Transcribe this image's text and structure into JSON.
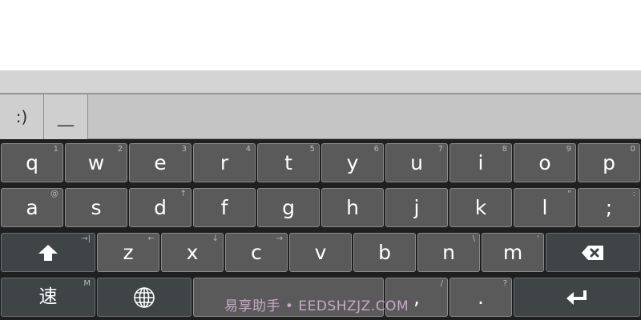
{
  "candidates": [
    ":)",
    "__"
  ],
  "rows": [
    [
      {
        "main": "q",
        "hint": "1"
      },
      {
        "main": "w",
        "hint": "2"
      },
      {
        "main": "e",
        "hint": "3"
      },
      {
        "main": "r",
        "hint": "4"
      },
      {
        "main": "t",
        "hint": "5"
      },
      {
        "main": "y",
        "hint": "6"
      },
      {
        "main": "u",
        "hint": "7"
      },
      {
        "main": "i",
        "hint": "8"
      },
      {
        "main": "o",
        "hint": "9"
      },
      {
        "main": "p",
        "hint": "0"
      }
    ],
    [
      {
        "main": "a",
        "hint": "@"
      },
      {
        "main": "s",
        "hint": ""
      },
      {
        "main": "d",
        "hint": "↑"
      },
      {
        "main": "f",
        "hint": ""
      },
      {
        "main": "g",
        "hint": ""
      },
      {
        "main": "h",
        "hint": ""
      },
      {
        "main": "j",
        "hint": ""
      },
      {
        "main": "k",
        "hint": ""
      },
      {
        "main": "l",
        "hint": "\""
      },
      {
        "main": ";",
        "hint": ":"
      }
    ],
    [
      {
        "main": "z",
        "hint": "←"
      },
      {
        "main": "x",
        "hint": "↓"
      },
      {
        "main": "c",
        "hint": "→"
      },
      {
        "main": "v",
        "hint": ""
      },
      {
        "main": "b",
        "hint": ""
      },
      {
        "main": "n",
        "hint": "\\"
      },
      {
        "main": "m",
        "hint": "'"
      }
    ]
  ],
  "shift_key": {
    "hint": "→|",
    "icon": "shift-arrow-icon"
  },
  "backspace_key": {
    "icon": "backspace-icon"
  },
  "bottom_row": {
    "lang_key": {
      "main": "速",
      "hint": "M"
    },
    "globe_key": {
      "icon": "globe-icon"
    },
    "comma_key": {
      "main": ",",
      "hint": "/"
    },
    "period_key": {
      "main": ".",
      "hint": "?"
    },
    "enter_key": {
      "icon": "enter-icon"
    }
  },
  "watermark": "易享助手 • EEDSHZJZ.COM",
  "colors": {
    "key_bg": "#5a5a5a",
    "func_key_bg": "#3f4446",
    "keyboard_bg": "#1f1f1f",
    "candidate_bar_bg": "#c5c5c5"
  }
}
